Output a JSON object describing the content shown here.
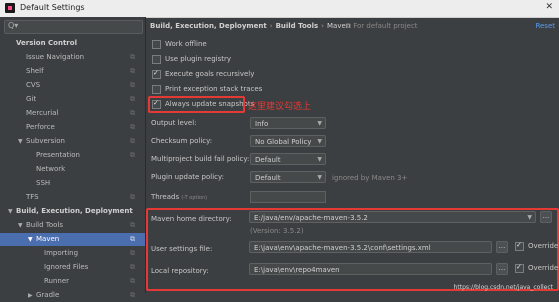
{
  "window": {
    "title": "Default Settings",
    "close": "✕"
  },
  "sidebar": {
    "search_icon": "Q▾",
    "items": [
      {
        "label": "Version Control"
      },
      {
        "label": "Issue Navigation"
      },
      {
        "label": "Shelf"
      },
      {
        "label": "CVS"
      },
      {
        "label": "Git"
      },
      {
        "label": "Mercurial"
      },
      {
        "label": "Perforce"
      },
      {
        "label": "Subversion"
      },
      {
        "label": "Presentation"
      },
      {
        "label": "Network"
      },
      {
        "label": "SSH"
      },
      {
        "label": "TFS"
      },
      {
        "label": "Build, Execution, Deployment"
      },
      {
        "label": "Build Tools"
      },
      {
        "label": "Maven"
      },
      {
        "label": "Importing"
      },
      {
        "label": "Ignored Files"
      },
      {
        "label": "Runner"
      },
      {
        "label": "Gradle"
      }
    ]
  },
  "breadcrumb": {
    "part1": "Build, Execution, Deployment",
    "part2": "Build Tools",
    "part3": "Maven",
    "project_note": "For default project",
    "separator": "›"
  },
  "reset_label": "Reset",
  "checkboxes": [
    {
      "label": "Work offline",
      "checked": false
    },
    {
      "label": "Use plugin registry",
      "checked": false
    },
    {
      "label": "Execute goals recursively",
      "checked": true
    },
    {
      "label": "Print exception stack traces",
      "checked": false
    },
    {
      "label": "Always update snapshots",
      "checked": true
    }
  ],
  "annotation": "这里建议勾选上",
  "fields": {
    "output_level": {
      "label": "Output level:",
      "value": "Info"
    },
    "checksum_policy": {
      "label": "Checksum policy:",
      "value": "No Global Policy"
    },
    "multiproject_fail_policy": {
      "label": "Multiproject build fail policy:",
      "value": "Default"
    },
    "plugin_update_policy": {
      "label": "Plugin update policy:",
      "value": "Default",
      "hint": "ignored by Maven 3+"
    },
    "threads": {
      "label": "Threads",
      "hint": "(-T option)",
      "value": ""
    },
    "maven_home": {
      "label": "Maven home directory:",
      "value": "E:/java/env/apache-maven-3.5.2",
      "version": "(Version: 3.5.2)"
    },
    "user_settings": {
      "label": "User settings file:",
      "value": "E:\\java\\env\\apache-maven-3.5.2\\conf\\settings.xml",
      "override": "Override"
    },
    "local_repo": {
      "label": "Local repository:",
      "value": "E:\\java\\env\\repo4maven",
      "override": "Override"
    }
  },
  "watermark": "https://blog.csdn.net/java_collect",
  "colors": {
    "accent": "#4b6eaf",
    "annotation": "#e53935",
    "link": "#589df6"
  }
}
